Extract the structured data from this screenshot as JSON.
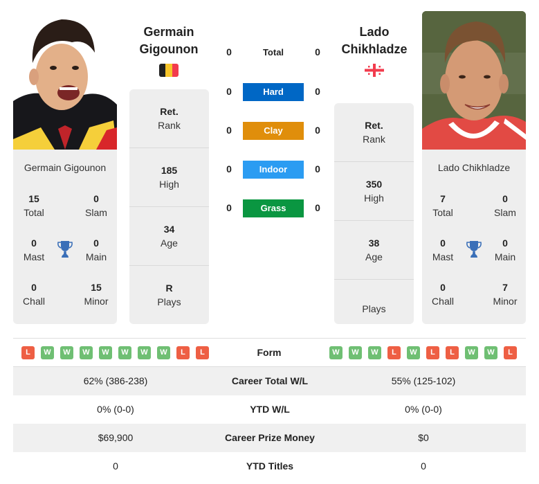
{
  "players": {
    "left": {
      "name_line1": "Germain",
      "name_line2": "Gigounon",
      "full_name": "Germain Gigounon",
      "flag": "belgium-flag",
      "flag_colors": [
        "#222222",
        "#f7c52b",
        "#f23b4d"
      ],
      "titles": {
        "total": {
          "value": "15",
          "label": "Total"
        },
        "slam": {
          "value": "0",
          "label": "Slam"
        },
        "mast": {
          "value": "0",
          "label": "Mast"
        },
        "main": {
          "value": "0",
          "label": "Main"
        },
        "chall": {
          "value": "0",
          "label": "Chall"
        },
        "minor": {
          "value": "15",
          "label": "Minor"
        }
      },
      "rank": {
        "value": "Ret.",
        "label": "Rank"
      },
      "high": {
        "value": "185",
        "label": "High"
      },
      "age": {
        "value": "34",
        "label": "Age"
      },
      "plays": {
        "value": "R",
        "label": "Plays"
      },
      "form": [
        "L",
        "W",
        "W",
        "W",
        "W",
        "W",
        "W",
        "W",
        "L",
        "L"
      ]
    },
    "right": {
      "name_line1": "Lado",
      "name_line2": "Chikhladze",
      "full_name": "Lado Chikhladze",
      "flag": "georgia-flag",
      "flag_colors": [
        "#ffffff",
        "#f23b4d"
      ],
      "titles": {
        "total": {
          "value": "7",
          "label": "Total"
        },
        "slam": {
          "value": "0",
          "label": "Slam"
        },
        "mast": {
          "value": "0",
          "label": "Mast"
        },
        "main": {
          "value": "0",
          "label": "Main"
        },
        "chall": {
          "value": "0",
          "label": "Chall"
        },
        "minor": {
          "value": "7",
          "label": "Minor"
        }
      },
      "rank": {
        "value": "Ret.",
        "label": "Rank"
      },
      "high": {
        "value": "350",
        "label": "High"
      },
      "age": {
        "value": "38",
        "label": "Age"
      },
      "plays": {
        "value": "",
        "label": "Plays"
      },
      "form": [
        "W",
        "W",
        "W",
        "L",
        "W",
        "L",
        "L",
        "W",
        "W",
        "L"
      ]
    }
  },
  "surfaces": [
    {
      "label": "Total",
      "left": "0",
      "right": "0",
      "color": ""
    },
    {
      "label": "Hard",
      "left": "0",
      "right": "0",
      "color": "#0067c5"
    },
    {
      "label": "Clay",
      "left": "0",
      "right": "0",
      "color": "#e08e0b"
    },
    {
      "label": "Indoor",
      "left": "0",
      "right": "0",
      "color": "#2b9cf2"
    },
    {
      "label": "Grass",
      "left": "0",
      "right": "0",
      "color": "#0a9641"
    }
  ],
  "form_label": "Form",
  "comparison": [
    {
      "label": "Career Total W/L",
      "left": "62% (386-238)",
      "right": "55% (125-102)"
    },
    {
      "label": "YTD W/L",
      "left": "0% (0-0)",
      "right": "0% (0-0)"
    },
    {
      "label": "Career Prize Money",
      "left": "$69,900",
      "right": "$0"
    },
    {
      "label": "YTD Titles",
      "left": "0",
      "right": "0"
    }
  ],
  "colors": {
    "win": "#6fbf73",
    "loss": "#ee5f44",
    "trophy": "#3a6fb8",
    "card_bg": "#eeeeee"
  }
}
